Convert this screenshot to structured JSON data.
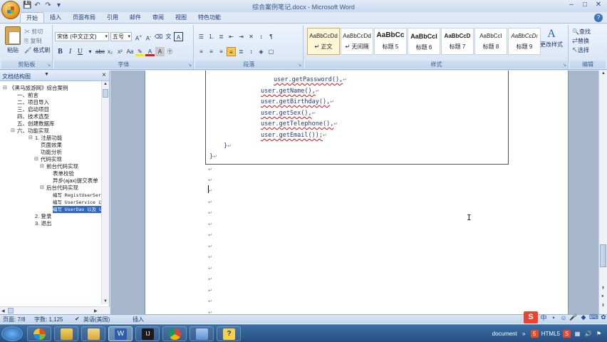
{
  "window": {
    "title": "综合案例笔记.docx - Microsoft Word"
  },
  "quick_access": {
    "save_icon": "save-icon",
    "undo_icon": "undo-icon",
    "redo_icon": "redo-icon"
  },
  "tabs": [
    {
      "label": "开始",
      "active": true
    },
    {
      "label": "插入"
    },
    {
      "label": "页面布局"
    },
    {
      "label": "引用"
    },
    {
      "label": "邮件"
    },
    {
      "label": "审阅"
    },
    {
      "label": "视图"
    },
    {
      "label": "特色功能"
    }
  ],
  "ribbon": {
    "clipboard": {
      "label": "剪贴板",
      "paste": "粘贴",
      "cut": "剪切",
      "copy": "复制",
      "format_painter": "格式刷"
    },
    "font": {
      "label": "字体",
      "font_name": "宋体 (中文正文)",
      "font_size": "五号"
    },
    "paragraph": {
      "label": "段落"
    },
    "styles": {
      "label": "样式",
      "items": [
        {
          "sample": "AaBbCcDd",
          "name": "↵ 正文",
          "selected": true
        },
        {
          "sample": "AaBbCcDd",
          "name": "↵ 无间隔"
        },
        {
          "sample": "AaBbCc",
          "name": "标题 5"
        },
        {
          "sample": "AaBbCcI",
          "name": "标题 6"
        },
        {
          "sample": "AaBbCcD",
          "name": "标题 7"
        },
        {
          "sample": "AaBbCcI",
          "name": "标题 8"
        },
        {
          "sample": "AaBbCcDı",
          "name": "标题 9"
        }
      ],
      "change_styles": "更改样式"
    },
    "editing": {
      "label": "编辑",
      "find": "查找",
      "replace": "替换",
      "select": "选择"
    }
  },
  "nav_pane": {
    "title": "文档结构图",
    "items": [
      {
        "text": "《黑马旅游网》综合案例"
      },
      {
        "text": "一、前言"
      },
      {
        "text": "二、项目导入"
      },
      {
        "text": "三、启动项目"
      },
      {
        "text": "四、技术选型"
      },
      {
        "text": "五、创建数据库"
      },
      {
        "text": "六、功能实现"
      },
      {
        "text": "1. 注册功能"
      },
      {
        "text": "页面效果"
      },
      {
        "text": "功能分析"
      },
      {
        "text": "代码实现"
      },
      {
        "text": "前台代码实现"
      },
      {
        "text": "表单校验"
      },
      {
        "text": "异步(ajax)提交表单"
      },
      {
        "text": "后台代码实现"
      },
      {
        "text": "编写 RegistUserServlet"
      },
      {
        "text": "编写 UserService 以"
      },
      {
        "text": "编写 UserDao 以及 U",
        "selected": true
      },
      {
        "text": "2. 登录"
      },
      {
        "text": "3. 退出"
      }
    ]
  },
  "document": {
    "code_lines": [
      {
        "text": "user.getPassword(),",
        "mark": "↵"
      },
      {
        "text": "user.getName(),",
        "mark": "↵"
      },
      {
        "text": "user.getBirthday(),",
        "mark": "↵"
      },
      {
        "text": "user.getSex(),",
        "mark": "↵"
      },
      {
        "text": "user.getTelephone(),",
        "mark": "↵"
      },
      {
        "text": "user.getEmail());",
        "mark": "↵"
      },
      {
        "text": "}",
        "mark": "↵"
      },
      {
        "text": "}",
        "mark": "↵"
      }
    ],
    "para_mark": "↵"
  },
  "status": {
    "page": "页面: 7/8",
    "words": "字数: 1,125",
    "language": "英语(美国)",
    "mode": "插入"
  },
  "tray": {
    "document": "document",
    "html5": "HTML5"
  }
}
